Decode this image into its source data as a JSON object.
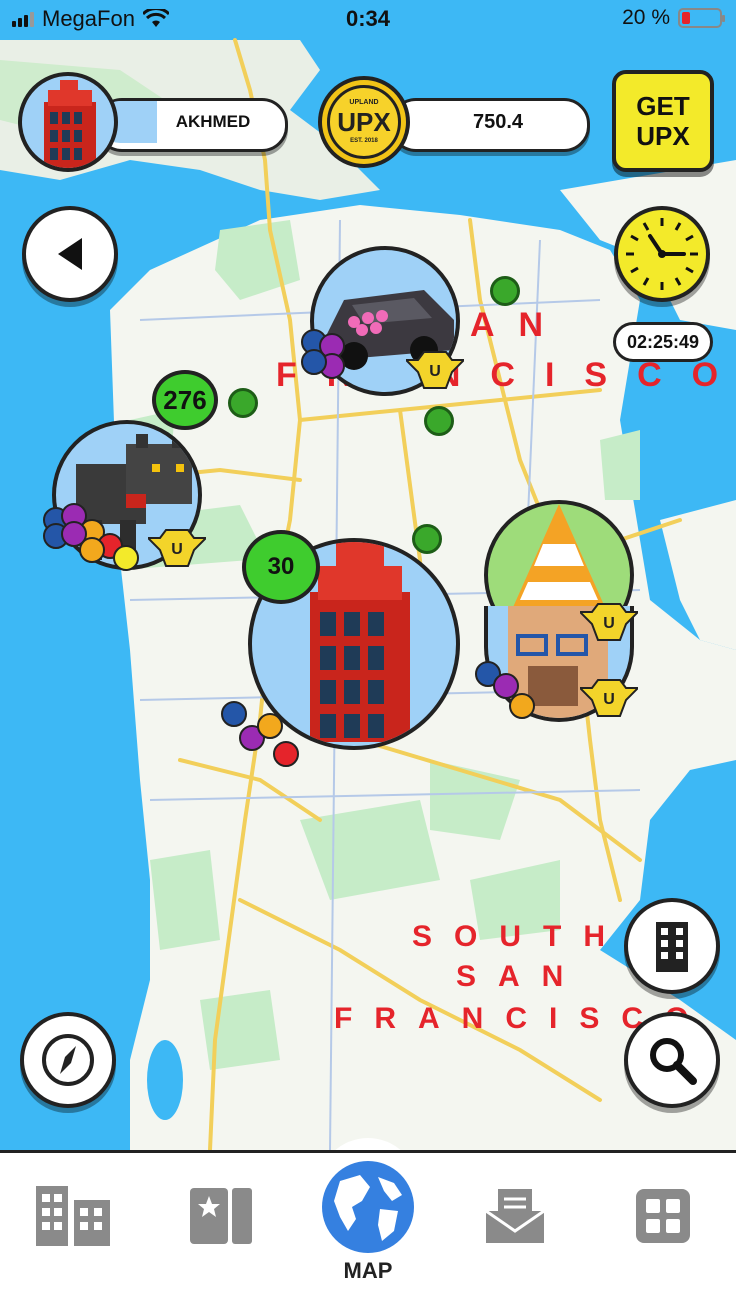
{
  "status_bar": {
    "carrier": "MegaFon",
    "time": "0:34",
    "battery": "20 %"
  },
  "header": {
    "username": "AKHMED",
    "balance": "750.4",
    "coin_label": "UPX",
    "coin_top": "UPLAND",
    "coin_bottom": "EST. 2018",
    "get_upx": "GET UPX"
  },
  "timer": "02:25:49",
  "map": {
    "labels": {
      "sf_line1": "AN",
      "sf_line2": "FRANCISCO",
      "south_line1": "SOUTH",
      "south_line2": "SAN",
      "south_line3": "FRANCISCO"
    },
    "badges": {
      "cluster_a": "276",
      "cluster_b": "30"
    }
  },
  "bottom_nav": {
    "items": [
      {
        "id": "properties",
        "icon": "buildings-icon"
      },
      {
        "id": "collections",
        "icon": "collection-book-icon"
      },
      {
        "id": "map",
        "icon": "globe-icon",
        "label": "MAP",
        "active": true
      },
      {
        "id": "inbox",
        "icon": "inbox-icon"
      },
      {
        "id": "menu",
        "icon": "grid-menu-icon"
      }
    ]
  },
  "colors": {
    "water": "#3db8f5",
    "land": "#f4f6f0",
    "park": "#c6ecc8",
    "road": "#f6d76b",
    "accent_red": "#e5242b",
    "badge_green": "#3fcc2e"
  }
}
